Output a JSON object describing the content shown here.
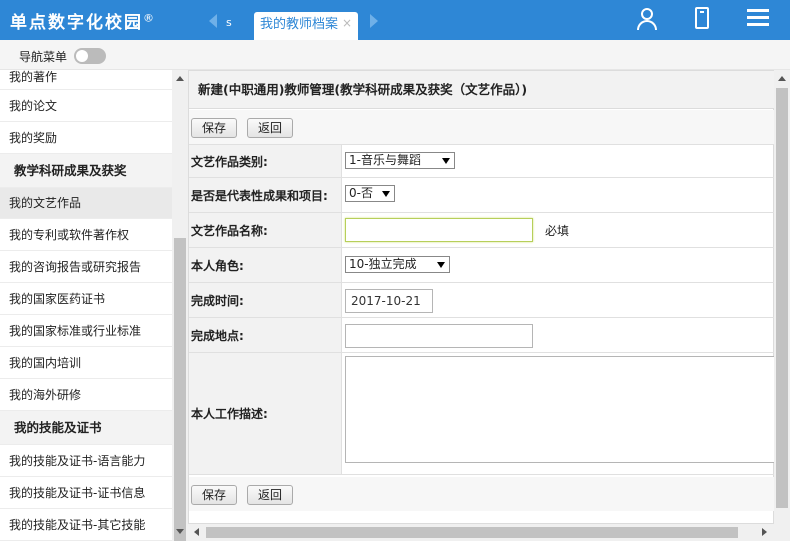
{
  "header": {
    "logo": "单点数字化校园",
    "logo_mark": "®",
    "tab_prev_label": "s",
    "active_tab": "我的教师档案",
    "tab_close": "×"
  },
  "navbar": {
    "label": "导航菜单",
    "toggle_on": false
  },
  "sidebar": {
    "items": [
      {
        "label": "我的著作",
        "type": "item"
      },
      {
        "label": "我的论文",
        "type": "item"
      },
      {
        "label": "我的奖励",
        "type": "item"
      },
      {
        "label": "教学科研成果及获奖",
        "type": "group"
      },
      {
        "label": "我的文艺作品",
        "type": "active"
      },
      {
        "label": "我的专利或软件著作权",
        "type": "item"
      },
      {
        "label": "我的咨询报告或研究报告",
        "type": "item"
      },
      {
        "label": "我的国家医药证书",
        "type": "item"
      },
      {
        "label": "我的国家标准或行业标准",
        "type": "item"
      },
      {
        "label": "我的国内培训",
        "type": "item"
      },
      {
        "label": "我的海外研修",
        "type": "item"
      },
      {
        "label": "我的技能及证书",
        "type": "group"
      },
      {
        "label": "我的技能及证书-语言能力",
        "type": "item"
      },
      {
        "label": "我的技能及证书-证书信息",
        "type": "item"
      },
      {
        "label": "我的技能及证书-其它技能",
        "type": "item"
      }
    ]
  },
  "form": {
    "title": "新建(中职通用)教师管理(教学科研成果及获奖（文艺作品）)",
    "save_label": "保存",
    "back_label": "返回",
    "fields": {
      "category": {
        "label": "文艺作品类别:",
        "value": "1-音乐与舞蹈"
      },
      "representative": {
        "label": "是否是代表性成果和项目:",
        "value": "0-否"
      },
      "name": {
        "label": "文艺作品名称:",
        "value": "",
        "required": "必填"
      },
      "role": {
        "label": "本人角色:",
        "value": "10-独立完成"
      },
      "date": {
        "label": "完成时间:",
        "value": "2017-10-21"
      },
      "place": {
        "label": "完成地点:",
        "value": ""
      },
      "description": {
        "label": "本人工作描述:",
        "value": ""
      }
    }
  }
}
